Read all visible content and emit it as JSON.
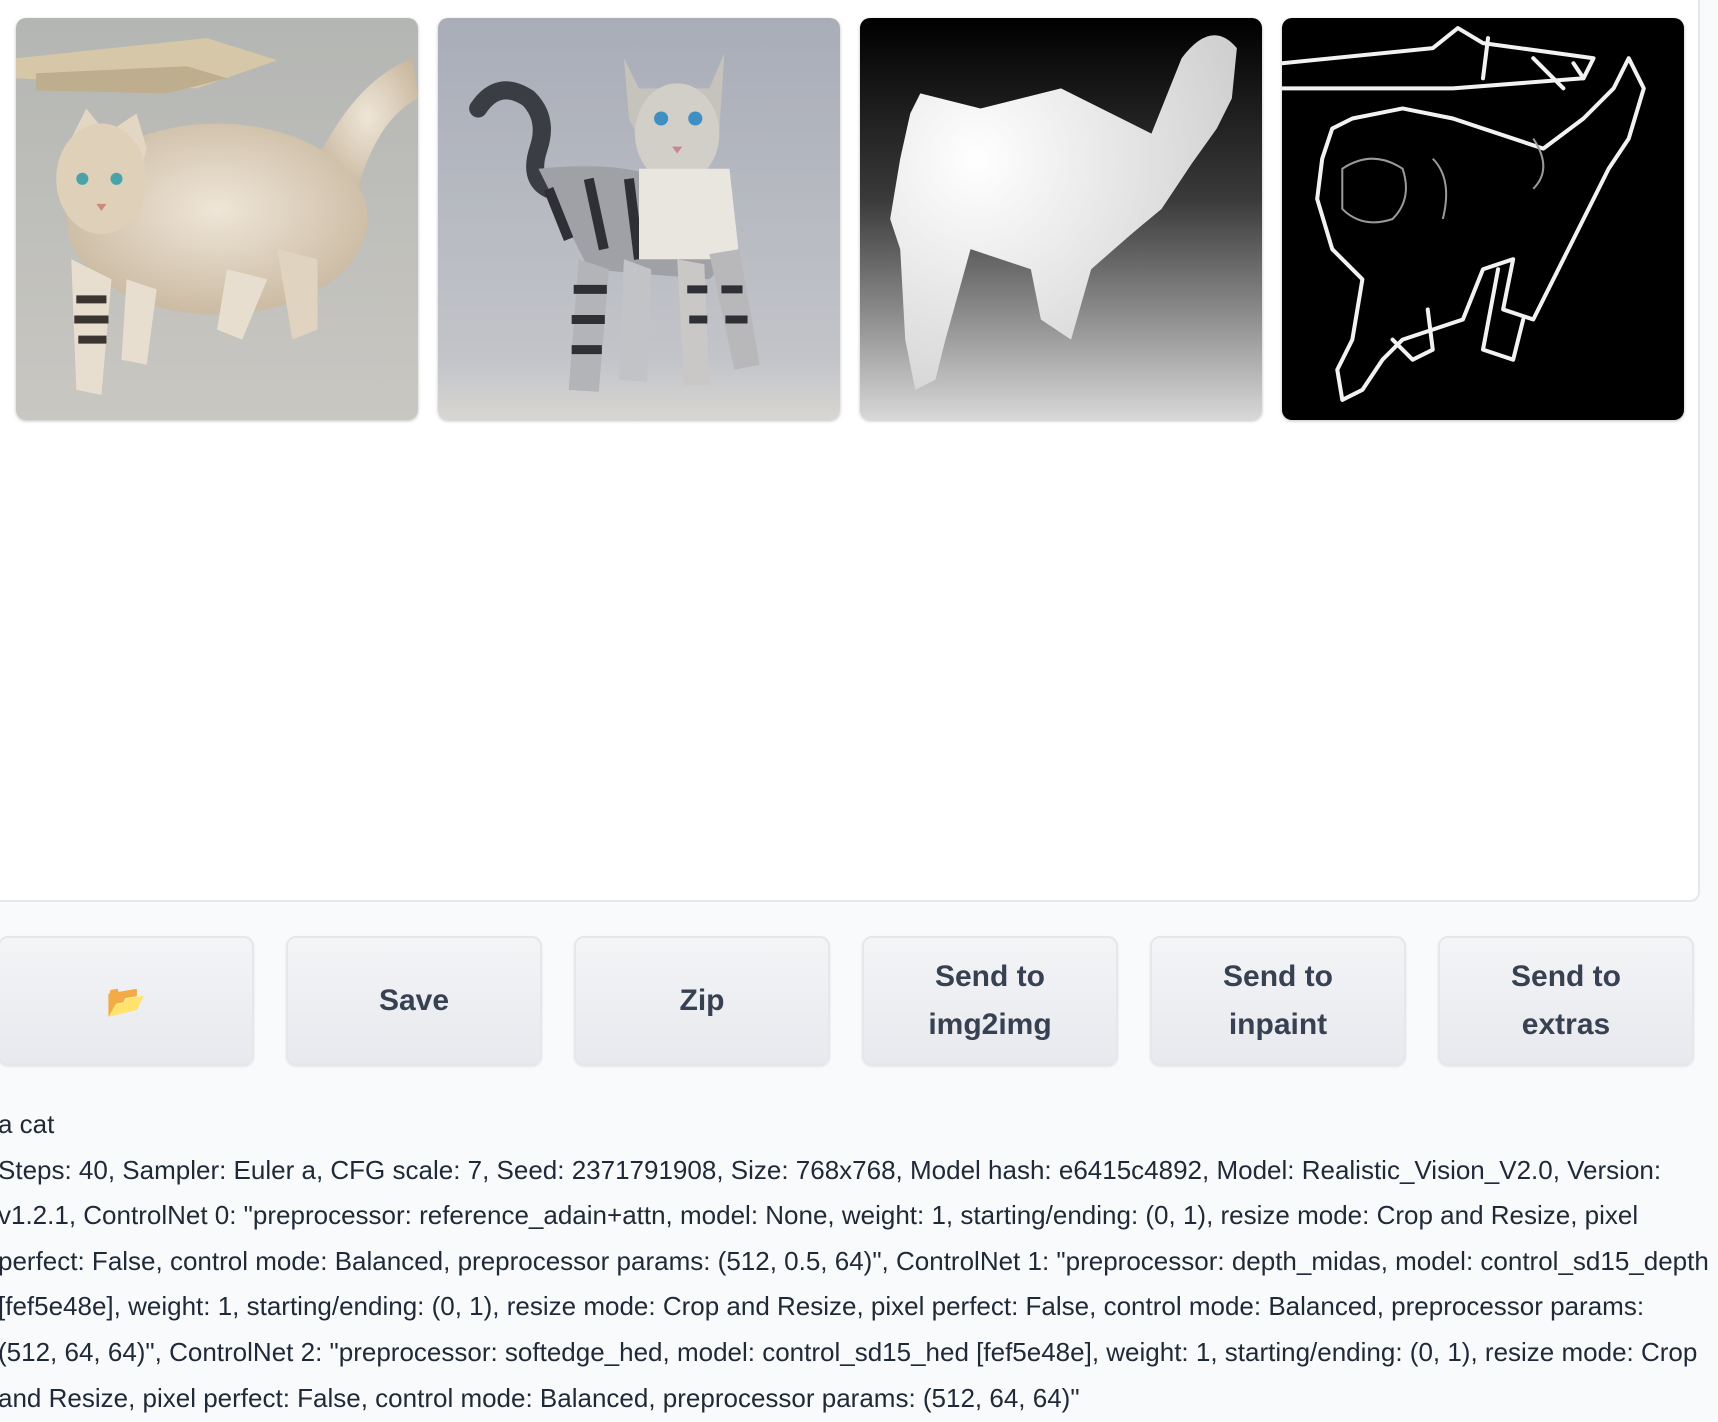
{
  "gallery": {
    "images": [
      {
        "label": "fluffy-cat-image"
      },
      {
        "label": "tabby-cat-image"
      },
      {
        "label": "depth-map-image"
      },
      {
        "label": "soft-edge-map-image"
      }
    ]
  },
  "toolbar": {
    "folder_icon": "📂",
    "save_label": "Save",
    "zip_label": "Zip",
    "send_img2img_label": "Send to\nimg2img",
    "send_inpaint_label": "Send to\ninpaint",
    "send_extras_label": "Send to\nextras"
  },
  "generation_info": {
    "prompt": "a cat",
    "parameters": "Steps: 40, Sampler: Euler a, CFG scale: 7, Seed: 2371791908, Size: 768x768, Model hash: e6415c4892, Model: Realistic_Vision_V2.0, Version: v1.2.1, ControlNet 0: \"preprocessor: reference_adain+attn, model: None, weight: 1, starting/ending: (0, 1), resize mode: Crop and Resize, pixel perfect: False, control mode: Balanced, preprocessor params: (512, 0.5, 64)\", ControlNet 1: \"preprocessor: depth_midas, model: control_sd15_depth [fef5e48e], weight: 1, starting/ending: (0, 1), resize mode: Crop and Resize, pixel perfect: False, control mode: Balanced, preprocessor params: (512, 64, 64)\", ControlNet 2: \"preprocessor: softedge_hed, model: control_sd15_hed [fef5e48e], weight: 1, starting/ending: (0, 1), resize mode: Crop and Resize, pixel perfect: False, control mode: Balanced, preprocessor params: (512, 64, 64)\""
  }
}
